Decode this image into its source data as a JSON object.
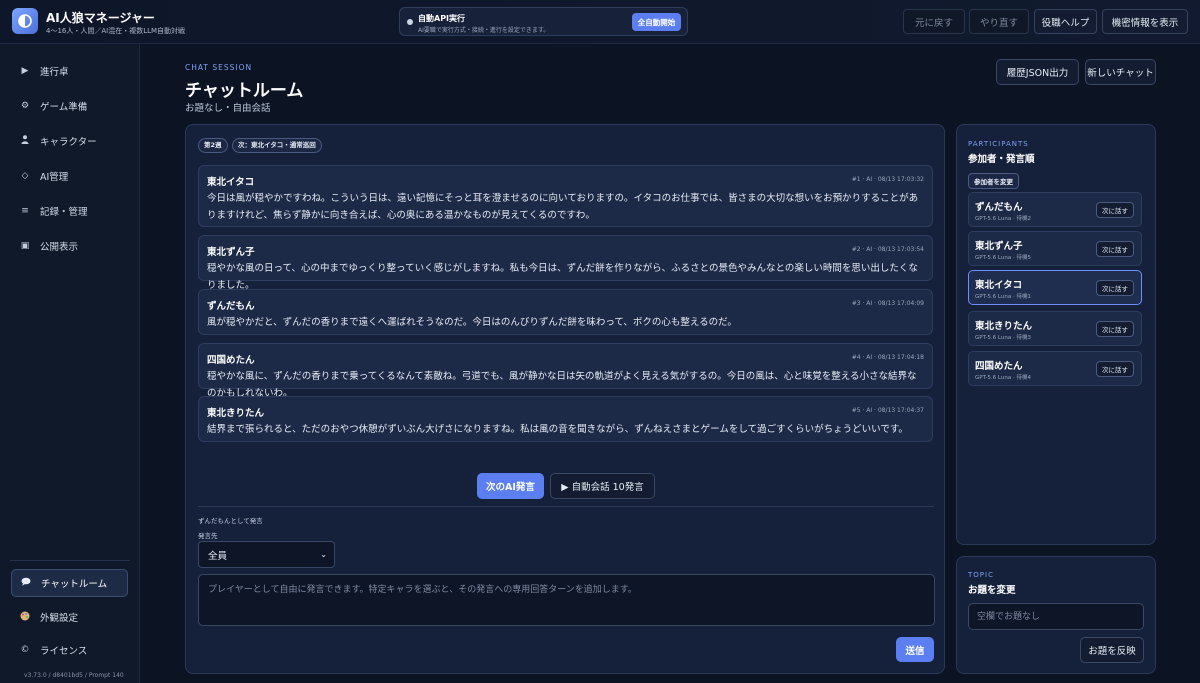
{
  "app": {
    "title": "AI人狼マネージャー",
    "subtitle": "4〜16人・人間／AI混在・複数LLM自動対戦",
    "logo_icon": "half-moon-icon"
  },
  "auto_api": {
    "title": "自動API実行",
    "description": "AI要職で実行方式・接続・進行を設定できます。",
    "button": "全自動開始"
  },
  "toolbar": {
    "undo": "元に戻す",
    "redo": "やり直す",
    "role_help": "役職ヘルプ",
    "show_secret": "機密情報を表示"
  },
  "sidebar": {
    "items": [
      {
        "icon": "play-icon",
        "glyph": "▶",
        "label": "進行卓"
      },
      {
        "icon": "gear-icon",
        "glyph": "⚙",
        "label": "ゲーム準備"
      },
      {
        "icon": "person-icon",
        "glyph": "👤",
        "label": "キャラクター"
      },
      {
        "icon": "diamond-icon",
        "glyph": "◇",
        "label": "AI管理"
      },
      {
        "icon": "list-icon",
        "glyph": "≡",
        "label": "記録・管理"
      },
      {
        "icon": "monitor-icon",
        "glyph": "▣",
        "label": "公開表示"
      }
    ],
    "bottom_items": [
      {
        "icon": "chat-bubble-icon",
        "glyph": "💬",
        "label": "チャットルーム",
        "active": true
      },
      {
        "icon": "palette-icon",
        "glyph": "🎨",
        "label": "外観設定"
      },
      {
        "icon": "copyright-icon",
        "glyph": "©",
        "label": "ライセンス"
      }
    ],
    "version": "v3.73.0 / d8401bd5 / Prompt 140"
  },
  "header": {
    "eyebrow": "CHAT SESSION",
    "title": "チャットルーム",
    "subtitle": "お題なし・自由会話",
    "export_button": "履歴JSON出力",
    "new_chat_button": "新しいチャット"
  },
  "chat": {
    "round_badge": "第2週",
    "next_badge": "次：東北イタコ・通常巡回",
    "messages": [
      {
        "name": "東北イタコ",
        "meta": "#1 · AI · 08/13 17:03:32",
        "text": "今日は風が穏やかですわね。こういう日は、遠い記憶にそっと耳を澄ませるのに向いておりますの。イタコのお仕事では、皆さまの大切な想いをお預かりすることがありますけれど、焦らず静かに向き合えば、心の奥にある温かなものが見えてくるのですわ。"
      },
      {
        "name": "東北ずん子",
        "meta": "#2 · AI · 08/13 17:03:54",
        "text": "穏やかな風の日って、心の中までゆっくり整っていく感じがしますね。私も今日は、ずんだ餅を作りながら、ふるさとの景色やみんなとの楽しい時間を思い出したくなりました。"
      },
      {
        "name": "ずんだもん",
        "meta": "#3 · AI · 08/13 17:04:09",
        "text": "風が穏やかだと、ずんだの香りまで遠くへ運ばれそうなのだ。今日はのんびりずんだ餅を味わって、ボクの心も整えるのだ。"
      },
      {
        "name": "四国めたん",
        "meta": "#4 · AI · 08/13 17:04:18",
        "text": "穏やかな風に、ずんだの香りまで乗ってくるなんて素敵ね。弓道でも、風が静かな日は矢の軌道がよく見える気がするの。今日の風は、心と味覚を整える小さな結界なのかもしれないわ。"
      },
      {
        "name": "東北きりたん",
        "meta": "#5 · AI · 08/13 17:04:37",
        "text": "結界まで張られると、ただのおやつ休憩がずいぶん大げさになりますね。私は風の音を聞きながら、ずんねえさまとゲームをして過ごすくらいがちょうどいいです。"
      }
    ],
    "next_ai_button": "次のAI発言",
    "auto_chat_button": "▶ 自動会話 10発言",
    "speaker_label": "ずんだもんとして発言",
    "target_label": "発言先",
    "target_value": "全員",
    "input_placeholder": "プレイヤーとして自由に発言できます。特定キャラを選ぶと、その発言への専用回答ターンを追加します。",
    "send_button": "送信"
  },
  "participants": {
    "eyebrow": "PARTICIPANTS",
    "title": "参加者・発言順",
    "change_button": "参加者を変更",
    "next_speak_label": "次に話す",
    "list": [
      {
        "name": "ずんだもん",
        "model": "GPT-5.6 Luna · 待機2",
        "active": false
      },
      {
        "name": "東北ずん子",
        "model": "GPT-5.6 Luna · 待機5",
        "active": false
      },
      {
        "name": "東北イタコ",
        "model": "GPT-5.6 Luna · 待機1",
        "active": true
      },
      {
        "name": "東北きりたん",
        "model": "GPT-5.6 Luna · 待機3",
        "active": false
      },
      {
        "name": "四国めたん",
        "model": "GPT-5.6 Luna · 待機4",
        "active": false
      }
    ]
  },
  "topic": {
    "eyebrow": "TOPIC",
    "title": "お題を変更",
    "placeholder": "空欄でお題なし",
    "apply_button": "お題を反映"
  },
  "colors": {
    "accent": "#5b7ef0",
    "background": "#0c1424",
    "panel": "#15203a"
  }
}
